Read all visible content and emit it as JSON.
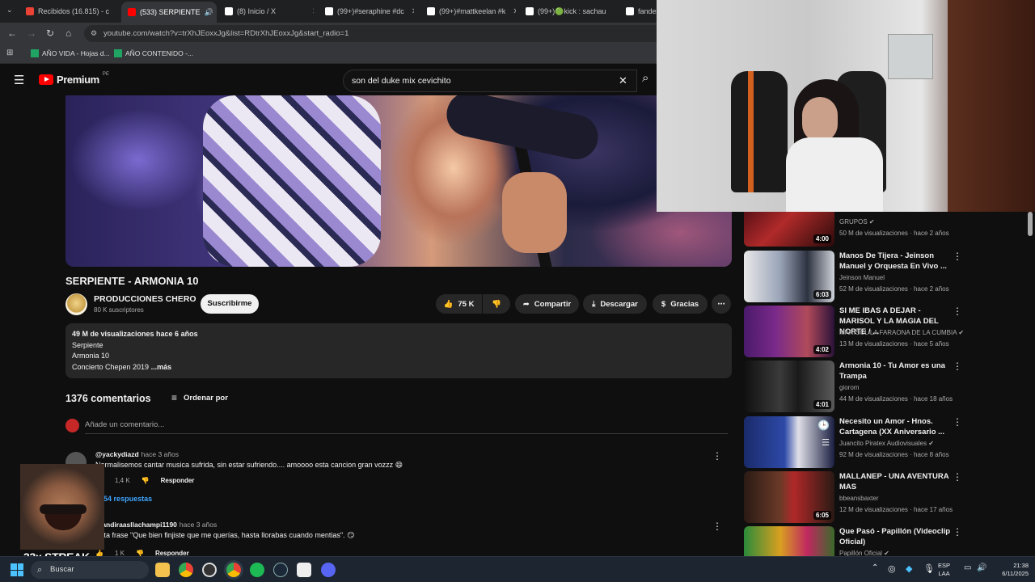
{
  "browser": {
    "tabs": [
      {
        "label": "Recibidos (16.815) - c",
        "color": "#ea4335"
      },
      {
        "label": "(533) SERPIENTE",
        "color": "#ff0000"
      },
      {
        "label": "(8) Inicio / X",
        "color": "#ffffff"
      },
      {
        "label": "(99+)#seraphine #dc",
        "color": "#ffffff"
      },
      {
        "label": "(99+)#mattkeelan #k",
        "color": "#ffffff"
      },
      {
        "label": "(99+)🟢kick : sachau",
        "color": "#ffffff"
      },
      {
        "label": "fanded",
        "color": "#ffffff"
      }
    ],
    "url": "youtube.com/watch?v=trXhJEoxxJg&list=RDtrXhJEoxxJg&start_radio=1",
    "bookmarks": [
      "AÑO VIDA - Hojas d...",
      "AÑO CONTENIDO -..."
    ]
  },
  "youtube": {
    "logo": "Premium",
    "region": "PE",
    "search_query": "son del duke mix cevichito"
  },
  "video": {
    "title": "SERPIENTE - ARMONIA 10",
    "channel": "PRODUCCIONES CHERO",
    "subscribers": "80 K suscriptores",
    "subscribe_label": "Suscribirme",
    "likes": "75 K",
    "share_label": "Compartir",
    "download_label": "Descargar",
    "thanks_label": "Gracias",
    "description": {
      "stats": "49 M de visualizaciones  hace 6 años",
      "lines": [
        "Serpiente",
        "Armonia 10",
        "Concierto Chepen 2019"
      ],
      "more": "...más"
    }
  },
  "comments": {
    "count_label": "1376 comentarios",
    "sort_label": "Ordenar por",
    "add_placeholder": "Añade un comentario...",
    "items": [
      {
        "user": "@yackydiazd",
        "time": "hace 3 años",
        "text": "Normalisemos cantar musica sufrida, sin estar sufriendo.... amoooo esta cancion gran vozzz 😄",
        "likes": "1,4 K",
        "reply_label": "Responder",
        "replies": "54 respuestas"
      },
      {
        "user": "@andiraasllachampi1190",
        "time": "hace 3 años",
        "text": "Esta frase \"Que bien finjiste que me querías, hasta llorabas cuando mentias\". 😏",
        "likes": "1 K",
        "reply_label": "Responder"
      }
    ]
  },
  "sidebar": {
    "items": [
      {
        "title": "",
        "channel": "GRUPOS",
        "meta": "50 M de visualizaciones · hace 2 años",
        "duration": "4:00",
        "verified": true
      },
      {
        "title": "Manos De Tijera - Jeinson Manuel y Orquesta En Vivo ...",
        "channel": "Jeinson Manuel",
        "meta": "52 M de visualizaciones · hace 2 años",
        "duration": "6:03",
        "verified": false
      },
      {
        "title": "SI ME IBAS A DEJAR - MARISOL Y LA MAGIA DEL NORTE / ...",
        "channel": "MARISOL LA FARAONA DE LA CUMBIA",
        "meta": "13 M de visualizaciones · hace 5 años",
        "duration": "4:02",
        "verified": true
      },
      {
        "title": "Armonia 10 - Tu Amor es una Trampa",
        "channel": "giorom",
        "meta": "44 M de visualizaciones · hace 18 años",
        "duration": "4:01",
        "verified": false
      },
      {
        "title": "Necesito un Amor - Hnos. Cartagena (XX Aniversario ...",
        "channel": "Juancito Piratex Audiovisuales",
        "meta": "92 M de visualizaciones · hace 8 años",
        "duration": "",
        "verified": true
      },
      {
        "title": "MALLANEP - UNA AVENTURA MAS",
        "channel": "bbeansbaxter",
        "meta": "12 M de visualizaciones · hace 17 años",
        "duration": "6:05",
        "verified": false
      },
      {
        "title": "Que Pasó - Papillón (Videoclip Oficial)",
        "channel": "Papillón Oficial",
        "meta": "",
        "duration": "",
        "verified": true
      }
    ]
  },
  "overlay": {
    "streak": "33x STREAK"
  },
  "taskbar": {
    "search_label": "Buscar",
    "lang_top": "ESP",
    "lang_bottom": "LAA",
    "time": "21:38",
    "date": "6/11/2025"
  }
}
